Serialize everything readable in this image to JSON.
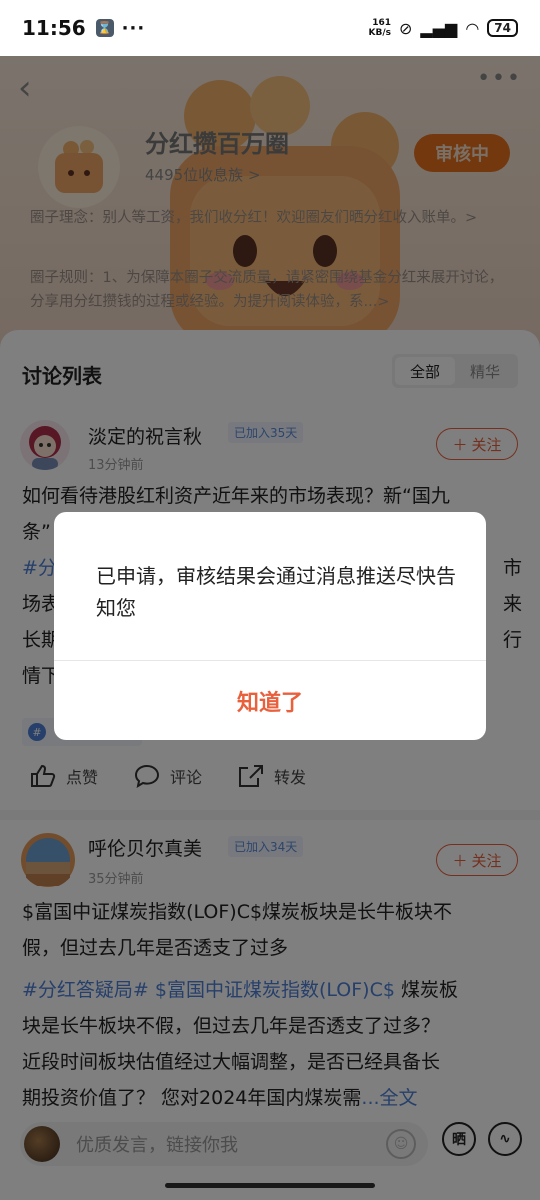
{
  "status_bar": {
    "time": "11:56",
    "dots": "···",
    "net_speed_value": "161",
    "net_speed_unit": "KB/s",
    "battery": "74"
  },
  "circle": {
    "title": "分红攒百万圈",
    "members": "4495位收息族 >",
    "review_label": "审核中",
    "concept": "圈子理念：别人等工资，我们收分红！欢迎圈友们晒分红收入账单。>",
    "rules": "圈子规则：1、为保障本圈子交流质量，请紧密围绕基金分红来展开讨论，分享用分红攒钱的过程或经验。为提升阅读体验，系...>"
  },
  "list": {
    "title": "讨论列表",
    "tabs": [
      "全部",
      "精华"
    ]
  },
  "posts": [
    {
      "name": "淡定的祝言秋",
      "tag": "已加入35天",
      "time": "13分钟前",
      "follow": "关注",
      "line1": "如何看待港股红利资产近年来的市场表现？新“国九",
      "line2": "条”",
      "line3_a": "#分",
      "line3_b": "市",
      "line4_a": "场表",
      "line4_b": "来",
      "line5_a": "长期",
      "line5_b": "行",
      "line6_a": "情下",
      "like": "点赞",
      "comment": "评论",
      "share": "转发"
    },
    {
      "name": "呼伦贝尔真美",
      "tag": "已加入34天",
      "time": "35分钟前",
      "follow": "关注",
      "title_line1": "$富国中证煤炭指数(LOF)C$煤炭板块是长牛板块不",
      "title_line2": "假，但过去几年是否透支了过多",
      "hash1": "#分红答疑局#",
      "hash2": "$富国中证煤炭指数(LOF)C$",
      "body1_tail": "煤炭板",
      "body2": "块是长牛板块不假，但过去几年是否透支了过多？",
      "body3": "近段时间板块估值经过大幅调整，是否已经具备长",
      "body4": "期投资价值了？ 您对2024年国内煤炭需",
      "more": "...全文"
    }
  ],
  "bottom": {
    "placeholder": "优质发言，链接你我",
    "show_label": "晒"
  },
  "dialog": {
    "message": "已申请，审核结果会通过消息推送尽快告知您",
    "confirm": "知道了"
  }
}
